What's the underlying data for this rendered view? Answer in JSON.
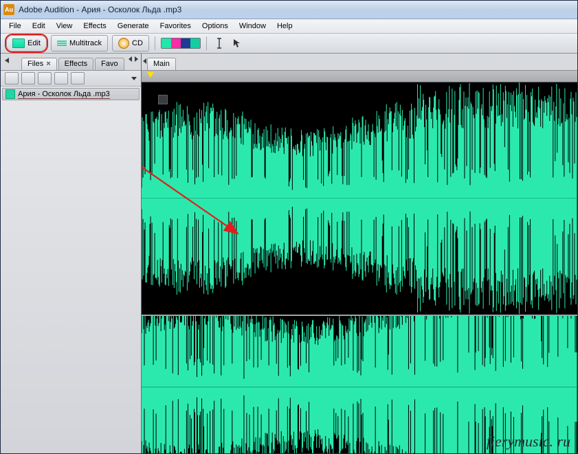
{
  "titlebar": {
    "app": "Adobe Audition",
    "file": "Ария - Осколок Льда .mp3",
    "badge": "Au"
  },
  "menus": {
    "file": "File",
    "edit": "Edit",
    "view": "View",
    "effects": "Effects",
    "generate": "Generate",
    "favorites": "Favorites",
    "options": "Options",
    "window": "Window",
    "help": "Help"
  },
  "toolbar": {
    "edit": "Edit",
    "multitrack": "Multitrack",
    "cd": "CD"
  },
  "sidebar": {
    "tabs": {
      "files": "Files",
      "effects": "Effects",
      "favorites": "Favo"
    },
    "file": "Ария - Осколок Льда .mp3"
  },
  "main_tabs": {
    "main": "Main"
  },
  "swatches": [
    "#1fe8aa",
    "#ff2aa6",
    "#1f3a93",
    "#10cfa0"
  ],
  "watermark": "fierymusic. ru"
}
